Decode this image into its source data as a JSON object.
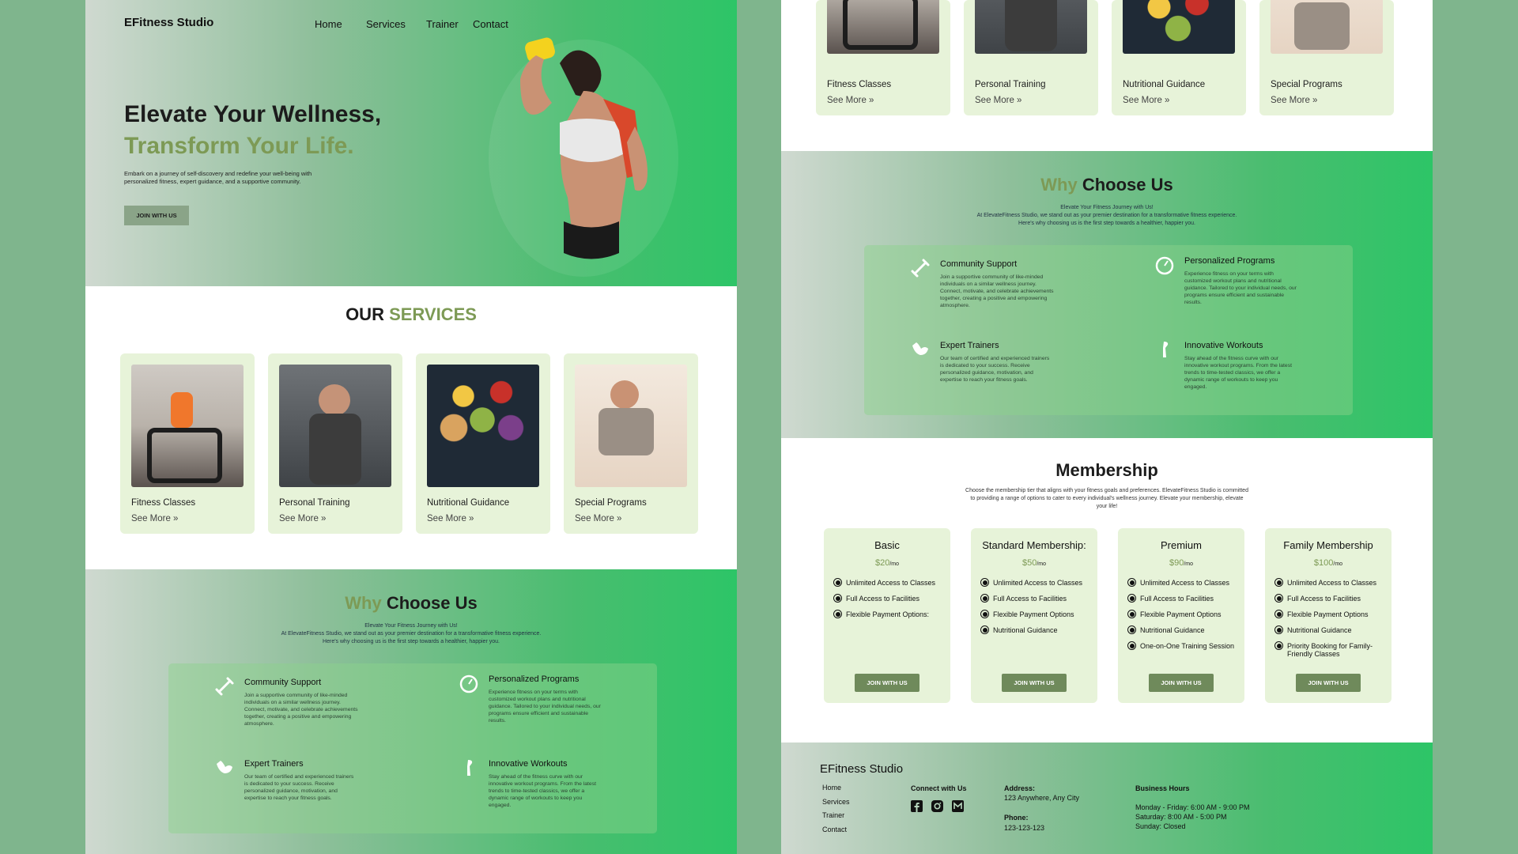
{
  "brand": "EFitness Studio",
  "nav": [
    "Home",
    "Services",
    "Trainer",
    "Contact"
  ],
  "hero": {
    "title_line1": "Elevate Your Wellness,",
    "title_line2": "Transform Your Life.",
    "description": "Embark on a journey of self-discovery and redefine your well-being with personalized fitness, expert guidance, and a supportive community.",
    "cta": "JOIN WITH US"
  },
  "services": {
    "title_plain": "OUR ",
    "title_accent": "SERVICES",
    "cards": [
      {
        "name": "Fitness Classes",
        "more": "See More »"
      },
      {
        "name": "Personal Training",
        "more": "See More »"
      },
      {
        "name": "Nutritional Guidance",
        "more": "See More »"
      },
      {
        "name": "Special Programs",
        "more": "See More »"
      }
    ]
  },
  "why": {
    "title_accent": "Why",
    "title_plain": " Choose Us",
    "sub1": "Elevate Your Fitness Journey with Us!",
    "sub2": "At ElevateFitness Studio, we stand out as your premier destination for a transformative fitness experience.",
    "sub3": "Here's why choosing us is the first step towards a healthier, happier you.",
    "features": [
      {
        "title": "Community Support",
        "icon": "dumbbell-icon",
        "text": "Join a supportive community of like-minded individuals on a similar wellness journey. Connect, motivate, and celebrate achievements together, creating a positive and empowering atmosphere."
      },
      {
        "title": "Personalized Programs",
        "icon": "scale-icon",
        "text": "Experience fitness on your terms with customized workout plans and nutritional guidance. Tailored to your individual needs, our programs ensure efficient and sustainable results."
      },
      {
        "title": "Expert Trainers",
        "icon": "bicep-icon",
        "text": "Our team of certified and experienced trainers is dedicated to your success. Receive personalized guidance, motivation, and expertise to reach your fitness goals."
      },
      {
        "title": "Innovative Workouts",
        "icon": "leg-icon",
        "text": "Stay ahead of the fitness curve with our innovative workout programs. From the latest trends to time-tested classics, we offer a dynamic range of workouts to keep you engaged."
      }
    ]
  },
  "membership": {
    "title": "Membership",
    "sub": "Choose the membership tier that aligns with your fitness goals and preferences. ElevateFitness Studio is committed to providing a range of options to cater to every individual's wellness journey. Elevate your membership, elevate your life!",
    "plans": [
      {
        "name": "Basic",
        "price": "$20",
        "per": "/mo",
        "features": [
          "Unlimited Access to Classes",
          "Full Access to Facilities",
          "Flexible Payment Options:"
        ],
        "cta": "JOIN WITH US"
      },
      {
        "name": "Standard Membership:",
        "price": "$50",
        "per": "/mo",
        "features": [
          "Unlimited Access to Classes",
          "Full Access to Facilities",
          "Flexible Payment Options",
          "Nutritional Guidance"
        ],
        "cta": "JOIN WITH US"
      },
      {
        "name": "Premium",
        "price": "$90",
        "per": "/mo",
        "features": [
          "Unlimited Access to Classes",
          "Full Access to Facilities",
          "Flexible Payment Options",
          "Nutritional Guidance",
          "One-on-One Training Session"
        ],
        "cta": "JOIN WITH US"
      },
      {
        "name": "Family Membership",
        "price": "$100",
        "per": "/mo",
        "features": [
          "Unlimited Access to Classes",
          "Full Access to Facilities",
          "Flexible Payment Options",
          "Nutritional Guidance",
          "Priority Booking for Family-Friendly Classes"
        ],
        "cta": "JOIN WITH US"
      }
    ]
  },
  "footer": {
    "brand": "EFitness Studio",
    "links": [
      "Home",
      "Services",
      "Trainer",
      "Contact"
    ],
    "connect": "Connect with Us",
    "social": [
      "facebook-icon",
      "instagram-icon",
      "gmail-icon"
    ],
    "address_label": "Address:",
    "address": "123 Anywhere, Any City",
    "phone_label": "Phone:",
    "phone": "123-123-123",
    "hours_label": "Business Hours",
    "hours": [
      "Monday - Friday: 6:00 AM - 9:00 PM",
      "Saturday: 8:00 AM - 5:00 PM",
      "Sunday: Closed"
    ]
  },
  "colors": {
    "accent": "#7d9a55",
    "green": "#2dc567",
    "card": "#e7f3d9",
    "button": "#6f8a5b"
  }
}
